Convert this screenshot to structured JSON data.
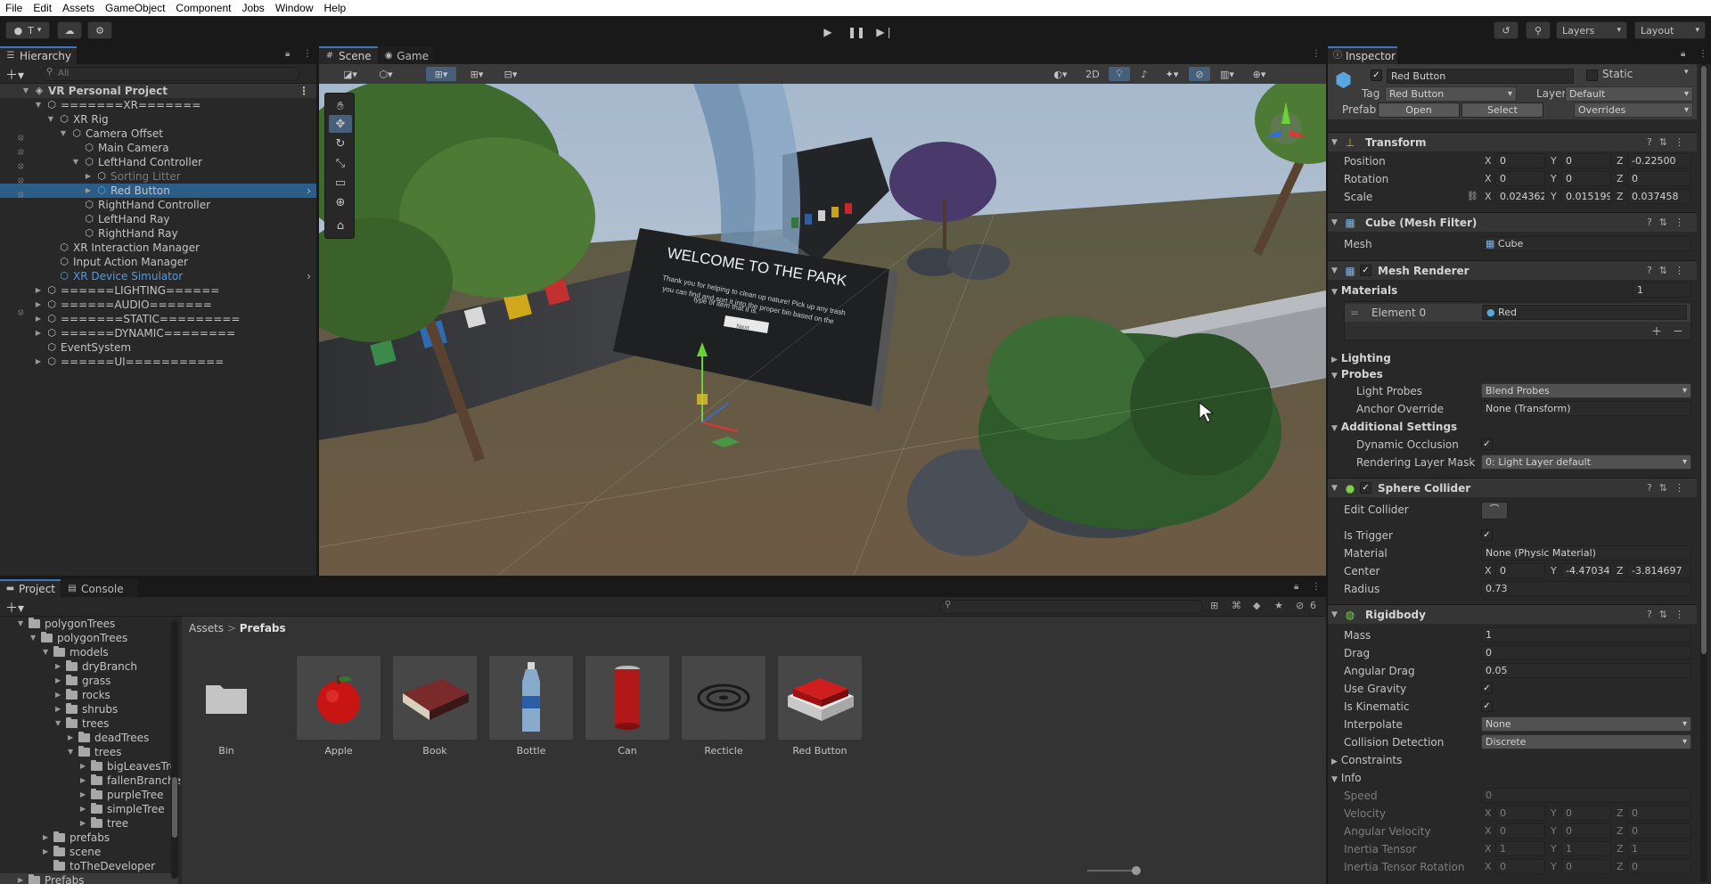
{
  "menu": [
    "File",
    "Edit",
    "Assets",
    "GameObject",
    "Component",
    "Jobs",
    "Window",
    "Help"
  ],
  "toolbar": {
    "account_label": "T",
    "layers_label": "Layers",
    "layout_label": "Layout"
  },
  "hierarchy": {
    "tab": "Hierarchy",
    "search_placeholder": "All",
    "rows": [
      {
        "label": "VR Personal Project",
        "depth": 0,
        "arrow": "▼",
        "kind": "scene"
      },
      {
        "label": "=======XR=======",
        "depth": 1,
        "arrow": "▼"
      },
      {
        "label": "XR Rig",
        "depth": 2,
        "arrow": "▼"
      },
      {
        "label": "Camera Offset",
        "depth": 3,
        "arrow": "▼"
      },
      {
        "label": "Main Camera",
        "depth": 4,
        "arrow": ""
      },
      {
        "label": "LeftHand Controller",
        "depth": 4,
        "arrow": "▼"
      },
      {
        "label": "Sorting Litter",
        "depth": 5,
        "arrow": "▶",
        "kind": "dim"
      },
      {
        "label": "Red Button",
        "depth": 5,
        "arrow": "▶",
        "kind": "sel"
      },
      {
        "label": "RightHand Controller",
        "depth": 4,
        "arrow": ""
      },
      {
        "label": "LeftHand Ray",
        "depth": 4,
        "arrow": ""
      },
      {
        "label": "RightHand Ray",
        "depth": 4,
        "arrow": ""
      },
      {
        "label": "XR Interaction Manager",
        "depth": 2,
        "arrow": ""
      },
      {
        "label": "Input Action Manager",
        "depth": 2,
        "arrow": ""
      },
      {
        "label": "XR Device Simulator",
        "depth": 2,
        "arrow": "",
        "kind": "blue"
      },
      {
        "label": "======LIGHTING======",
        "depth": 1,
        "arrow": "▶"
      },
      {
        "label": "======AUDIO=======",
        "depth": 1,
        "arrow": "▶"
      },
      {
        "label": "=======STATIC=========",
        "depth": 1,
        "arrow": "▶"
      },
      {
        "label": "======DYNAMIC========",
        "depth": 1,
        "arrow": "▶"
      },
      {
        "label": "EventSystem",
        "depth": 1,
        "arrow": ""
      },
      {
        "label": "======UI===========",
        "depth": 1,
        "arrow": "▶"
      }
    ]
  },
  "scene": {
    "tabs": [
      "Scene",
      "Game"
    ],
    "toolbar_2d": "2D",
    "sign_title": "WELCOME TO THE PARK",
    "sign_body": "Thank you for helping to clean up nature! Pick up any trash you can find and sort it into the proper bin based on the type of item that it is.",
    "sign_button": "Next"
  },
  "inspector": {
    "tab": "Inspector",
    "object_name": "Red Button",
    "static_label": "Static",
    "tag_label": "Tag",
    "tag_value": "Red Button",
    "layer_label": "Layer",
    "layer_value": "Default",
    "prefab_label": "Prefab",
    "open_label": "Open",
    "select_label": "Select",
    "overrides_label": "Overrides",
    "transform": {
      "title": "Transform",
      "position_label": "Position",
      "position": [
        "0",
        "0",
        "-0.22500"
      ],
      "rotation_label": "Rotation",
      "rotation": [
        "0",
        "0",
        "0"
      ],
      "scale_label": "Scale",
      "scale": [
        "0.024362",
        "0.0151995",
        "0.037458"
      ]
    },
    "mesh_filter": {
      "title": "Cube (Mesh Filter)",
      "mesh_label": "Mesh",
      "mesh_value": "Cube"
    },
    "mesh_renderer": {
      "title": "Mesh Renderer",
      "materials_label": "Materials",
      "materials_count": "1",
      "element_label": "Element 0",
      "element_value": "Red",
      "lighting_label": "Lighting",
      "probes_label": "Probes",
      "light_probes_label": "Light Probes",
      "light_probes_value": "Blend Probes",
      "anchor_label": "Anchor Override",
      "anchor_value": "None (Transform)",
      "additional_label": "Additional Settings",
      "dyn_occlusion_label": "Dynamic Occlusion",
      "rendering_layer_label": "Rendering Layer Mask",
      "rendering_layer_value": "0: Light Layer default"
    },
    "sphere_collider": {
      "title": "Sphere Collider",
      "edit_collider_label": "Edit Collider",
      "is_trigger_label": "Is Trigger",
      "material_label": "Material",
      "material_value": "None (Physic Material)",
      "center_label": "Center",
      "center": [
        "0",
        "-4.47034",
        "-3.814697"
      ],
      "radius_label": "Radius",
      "radius": "0.73"
    },
    "rigidbody": {
      "title": "Rigidbody",
      "mass_label": "Mass",
      "mass": "1",
      "drag_label": "Drag",
      "drag": "0",
      "angular_drag_label": "Angular Drag",
      "angular_drag": "0.05",
      "use_gravity_label": "Use Gravity",
      "is_kinematic_label": "Is Kinematic",
      "interpolate_label": "Interpolate",
      "interpolate": "None",
      "collision_label": "Collision Detection",
      "collision": "Discrete",
      "constraints_label": "Constraints",
      "info_label": "Info",
      "speed_label": "Speed",
      "speed": "0",
      "velocity_label": "Velocity",
      "velocity": [
        "0",
        "0",
        "0"
      ],
      "ang_velocity_label": "Angular Velocity",
      "ang_velocity": [
        "0",
        "0",
        "0"
      ],
      "inertia_label": "Inertia Tensor",
      "inertia": [
        "1",
        "1",
        "1"
      ],
      "inertia_rot_label": "Inertia Tensor Rotation",
      "inertia_rot": [
        "0",
        "0",
        "0"
      ]
    },
    "axis": [
      "X",
      "Y",
      "Z"
    ]
  },
  "project": {
    "tabs": [
      "Project",
      "Console"
    ],
    "hidden_count": "6",
    "breadcrumb_root": "Assets",
    "breadcrumb_current": "Prefabs",
    "tree": [
      {
        "label": "polygonTrees",
        "depth": 1,
        "arrow": "▼"
      },
      {
        "label": "polygonTrees",
        "depth": 2,
        "arrow": "▼"
      },
      {
        "label": "models",
        "depth": 3,
        "arrow": "▼"
      },
      {
        "label": "dryBranch",
        "depth": 4,
        "arrow": "▶"
      },
      {
        "label": "grass",
        "depth": 4,
        "arrow": "▶"
      },
      {
        "label": "rocks",
        "depth": 4,
        "arrow": "▶"
      },
      {
        "label": "shrubs",
        "depth": 4,
        "arrow": "▶"
      },
      {
        "label": "trees",
        "depth": 4,
        "arrow": "▼"
      },
      {
        "label": "deadTrees",
        "depth": 5,
        "arrow": "▶"
      },
      {
        "label": "trees",
        "depth": 5,
        "arrow": "▼"
      },
      {
        "label": "bigLeavesTre",
        "depth": 6,
        "arrow": "▶"
      },
      {
        "label": "fallenBranche",
        "depth": 6,
        "arrow": "▶"
      },
      {
        "label": "purpleTree",
        "depth": 6,
        "arrow": "▶"
      },
      {
        "label": "simpleTree",
        "depth": 6,
        "arrow": "▶"
      },
      {
        "label": "tree",
        "depth": 6,
        "arrow": "▶"
      },
      {
        "label": "prefabs",
        "depth": 3,
        "arrow": "▶"
      },
      {
        "label": "scene",
        "depth": 3,
        "arrow": "▶"
      },
      {
        "label": "toTheDeveloper",
        "depth": 3,
        "arrow": ""
      },
      {
        "label": "Prefabs",
        "depth": 1,
        "arrow": "▶",
        "kind": "sel"
      }
    ],
    "assets": [
      "Bin",
      "Apple",
      "Book",
      "Bottle",
      "Can",
      "Recticle",
      "Red Button"
    ]
  }
}
